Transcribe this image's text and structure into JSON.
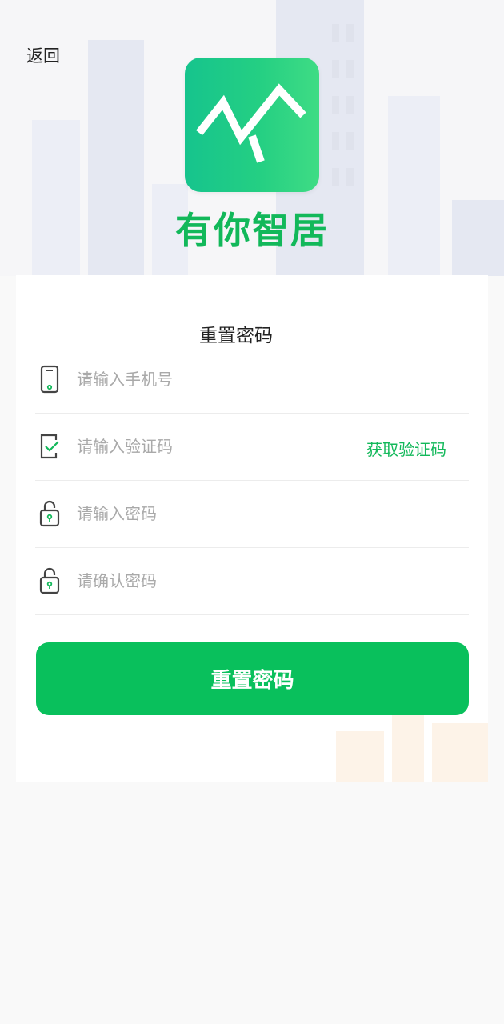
{
  "nav": {
    "back_label": "返回"
  },
  "brand": {
    "name": "有你智居",
    "logo_icon": "house-roof-logo-icon",
    "accent": "#12b85a"
  },
  "form": {
    "title": "重置密码",
    "phone": {
      "placeholder": "请输入手机号",
      "value": "",
      "icon": "phone-icon"
    },
    "code": {
      "placeholder": "请输入验证码",
      "value": "",
      "icon": "verify-check-icon",
      "get_code_label": "获取验证码"
    },
    "password": {
      "placeholder": "请输入密码",
      "value": "",
      "icon": "lock-icon"
    },
    "confirm": {
      "placeholder": "请确认密码",
      "value": "",
      "icon": "lock-icon"
    },
    "submit_label": "重置密码",
    "submit_color": "#09c05c"
  }
}
